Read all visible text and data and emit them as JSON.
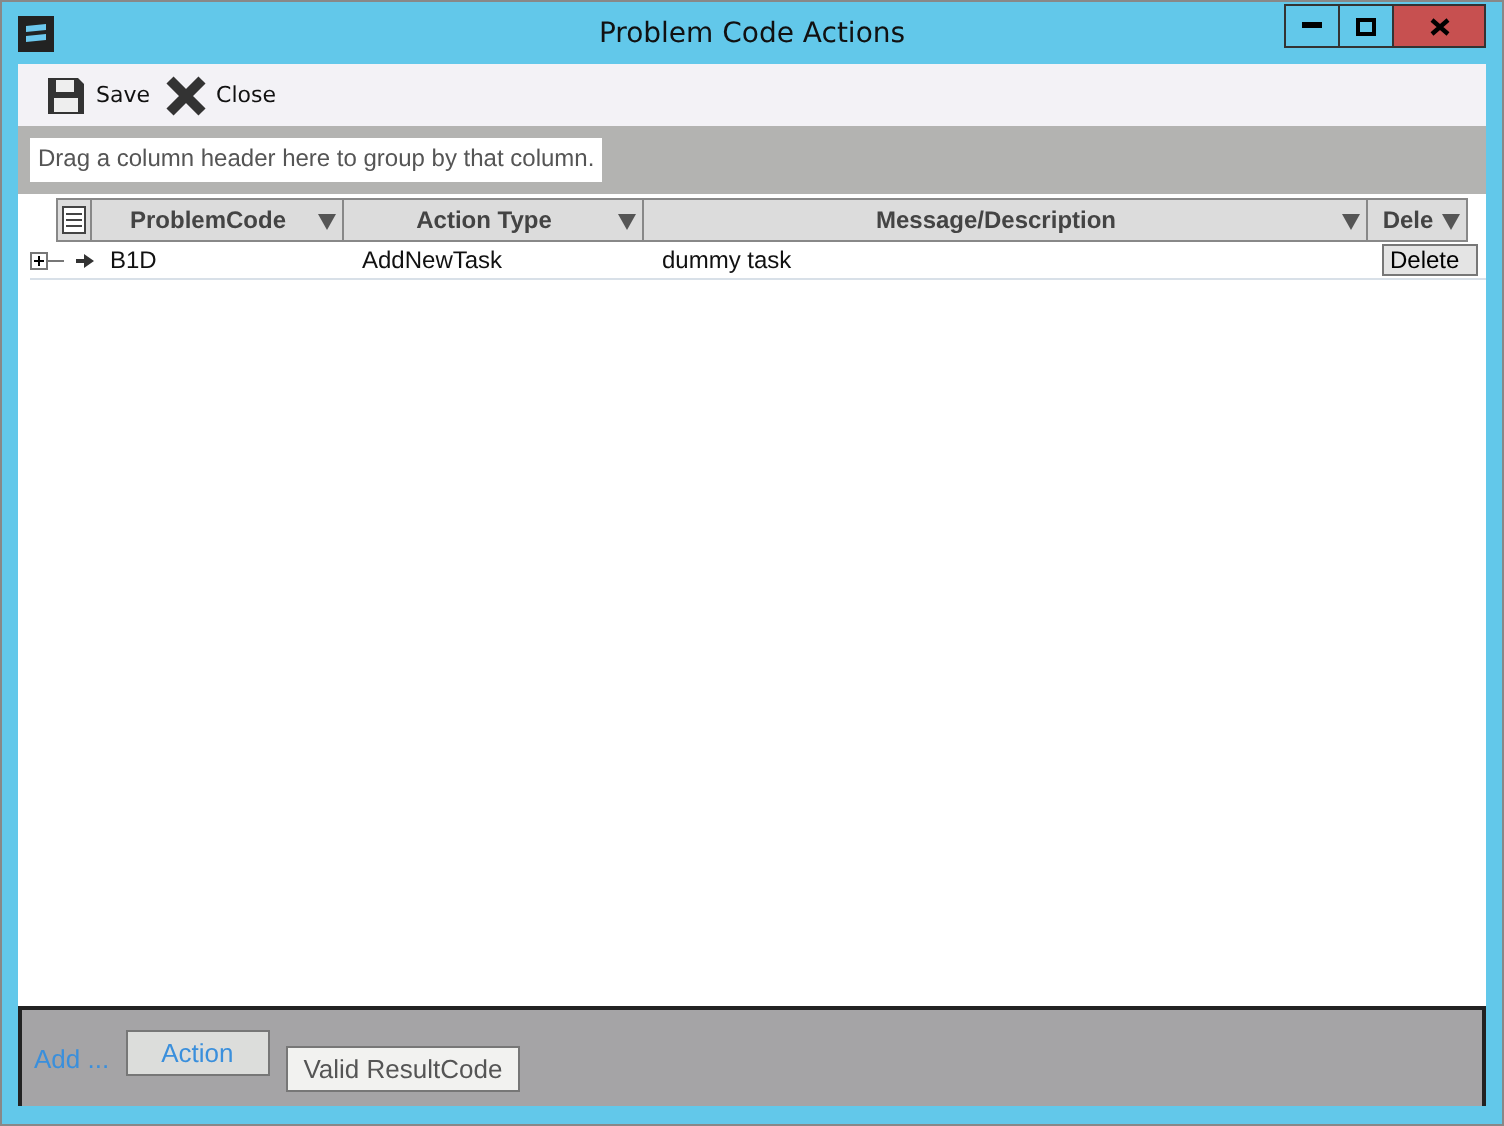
{
  "window": {
    "title": "Problem Code Actions"
  },
  "toolbar": [
    {
      "kind": "save",
      "label": "Save"
    },
    {
      "kind": "close",
      "label": "Close"
    }
  ],
  "group_panel": {
    "placeholder": "Drag a column header here to group by that column."
  },
  "table": {
    "columns": [
      "ProblemCode",
      "Action Type",
      "Message/Description",
      "Dele"
    ],
    "rows": [
      {
        "cells": [
          "B1D",
          "AddNewTask",
          "dummy task"
        ],
        "button": "Delete",
        "expanded": false
      }
    ]
  },
  "footer": {
    "label": "Add ...",
    "tabs": [
      {
        "label": "Action",
        "selected": true
      },
      {
        "label": "Valid ResultCode",
        "selected": false
      }
    ]
  }
}
